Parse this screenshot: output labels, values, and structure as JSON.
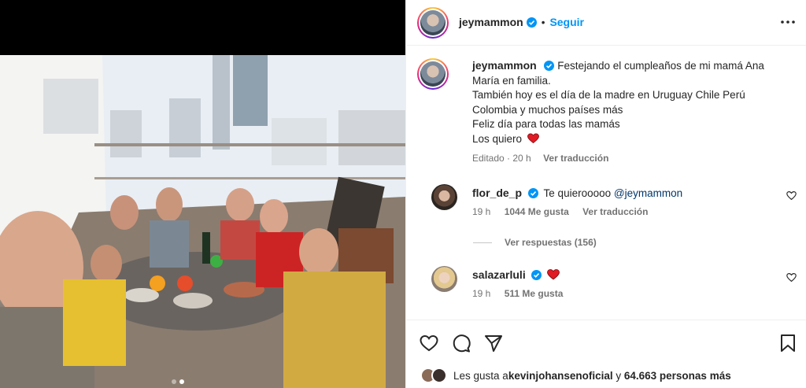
{
  "post": {
    "author": "jeymammon",
    "follow_label": "Seguir",
    "carousel": {
      "total": 2,
      "active": 2
    }
  },
  "caption": {
    "username": "jeymammon",
    "lines": [
      "Festejando el cumpleaños de mi mamá Ana",
      "María en familia.",
      "También hoy es el día de la madre en Uruguay Chile Perú",
      "Colombia y muchos países más",
      "Feliz día para todas las mamás",
      "Los quiero"
    ],
    "edited": "Editado · 20 h",
    "translate": "Ver traducción"
  },
  "comments": [
    {
      "username": "flor_de_p",
      "text": "Te quierooooo ",
      "mention": "@jeymammon",
      "time": "19 h",
      "likes": "1044 Me gusta",
      "translate": "Ver traducción"
    },
    {
      "username": "salazarluli",
      "time": "19 h",
      "likes": "511 Me gusta"
    }
  ],
  "replies_label": "Ver respuestas (156)",
  "likes_summary": {
    "prefix": "Les gusta a ",
    "user": "kevinjohansenoficial",
    "middle": " y ",
    "count": "64.663 personas más"
  },
  "colors": {
    "accent": "#0095f6",
    "verified": "#0095f6",
    "heart": "#ff3040",
    "muted": "#737373"
  },
  "icons": {
    "verified": "verified-badge-icon",
    "more": "more-options-icon",
    "like": "heart-outline-icon",
    "comment": "speech-bubble-icon",
    "share": "paper-plane-icon",
    "save": "bookmark-icon",
    "emoji_heart": "red-heart-emoji"
  }
}
